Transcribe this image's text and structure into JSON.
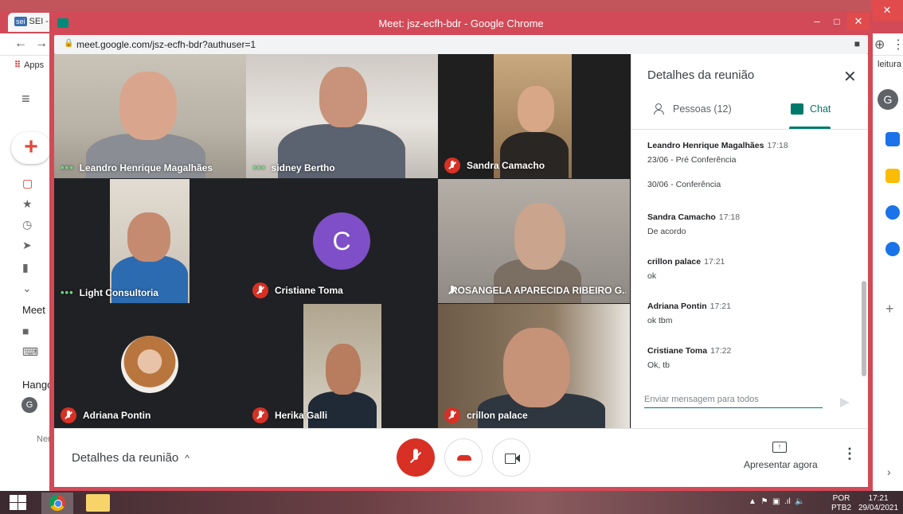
{
  "background": {
    "tab_label": "SEI -",
    "tab_badge": "sei",
    "apps_label": "Apps",
    "reading_list_label": "leitura",
    "meet_section": "Meet",
    "hangouts_section": "Hango",
    "avatar_initial": "G",
    "hangouts_user_initial": "G",
    "truncated_text": "Ner"
  },
  "window": {
    "title": "Meet: jsz-ecfh-bdr - Google Chrome",
    "url": "meet.google.com/jsz-ecfh-bdr?authuser=1"
  },
  "participants": [
    {
      "name": "Leandro Henrique Magalhães",
      "status": "speaking"
    },
    {
      "name": "sidney Bertho",
      "status": "speaking"
    },
    {
      "name": "Sandra Camacho",
      "status": "muted"
    },
    {
      "name": "Light Consultoria",
      "status": "speaking"
    },
    {
      "name": "Cristiane Toma",
      "status": "muted",
      "avatar_letter": "C"
    },
    {
      "name": "ROSANGELA APARECIDA RIBEIRO G...",
      "status": "muted"
    },
    {
      "name": "Adriana Pontin",
      "status": "muted"
    },
    {
      "name": "Herika Galli",
      "status": "muted"
    },
    {
      "name": "crillon palace",
      "status": "muted"
    }
  ],
  "bottom_bar": {
    "details_label": "Detalhes da reunião",
    "present_label": "Apresentar agora"
  },
  "panel": {
    "title": "Detalhes da reunião",
    "tab_people": "Pessoas (12)",
    "tab_chat": "Chat",
    "composer_placeholder": "Enviar mensagem para todos",
    "messages": [
      {
        "sender": "Leandro Henrique Magalhães",
        "time": "17:18",
        "lines": [
          "23/06 - Pré Conferência",
          "30/06 - Conferência"
        ]
      },
      {
        "sender": "Sandra Camacho",
        "time": "17:18",
        "lines": [
          "De acordo"
        ]
      },
      {
        "sender": "crillon palace",
        "time": "17:21",
        "lines": [
          "ok"
        ]
      },
      {
        "sender": "Adriana Pontin",
        "time": "17:21",
        "lines": [
          "ok tbm"
        ]
      },
      {
        "sender": "Cristiane Toma",
        "time": "17:22",
        "lines": [
          "Ok, tb"
        ]
      }
    ]
  },
  "taskbar": {
    "lang_top": "POR",
    "lang_bottom": "PTB2",
    "time": "17:21",
    "date": "29/04/2021"
  },
  "colors": {
    "window_frame": "#d24a57",
    "muted_red": "#d93025",
    "chat_accent": "#00796b",
    "avatar_purple": "#7e4fc6"
  }
}
